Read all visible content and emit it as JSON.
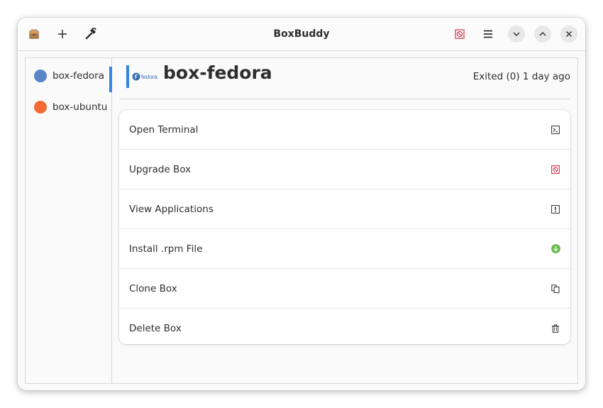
{
  "window": {
    "title": "BoxBuddy",
    "app_icon": "package-icon",
    "header_left": [
      {
        "name": "add-box-button",
        "icon": "plus-icon"
      },
      {
        "name": "tools-button",
        "icon": "hammer-icon"
      }
    ],
    "header_right": [
      {
        "name": "stop-button",
        "icon": "no-entry-icon"
      },
      {
        "name": "main-menu-button",
        "icon": "hamburger-icon"
      },
      {
        "name": "minimize-button",
        "icon": "chevron-down-icon"
      },
      {
        "name": "maximize-button",
        "icon": "chevron-up-icon"
      },
      {
        "name": "close-button",
        "icon": "close-icon"
      }
    ]
  },
  "sidebar": {
    "items": [
      {
        "label": "box-fedora",
        "color": "#5b85c6",
        "selected": true
      },
      {
        "label": "box-ubuntu",
        "color": "#f26a35",
        "selected": false
      }
    ]
  },
  "main": {
    "logo_text": "fedora",
    "box_name": "box-fedora",
    "status": "Exited (0) 1 day ago",
    "actions": [
      {
        "label": "Open Terminal",
        "icon": "terminal-icon"
      },
      {
        "label": "Upgrade Box",
        "icon": "no-entry-icon"
      },
      {
        "label": "View Applications",
        "icon": "app-list-icon"
      },
      {
        "label": "Install .rpm File",
        "icon": "download-icon"
      },
      {
        "label": "Clone Box",
        "icon": "copy-icon"
      },
      {
        "label": "Delete Box",
        "icon": "trash-icon"
      }
    ]
  },
  "colors": {
    "accent": "#3584e4",
    "stop_red": "#d0334a",
    "download_green": "#6abf4b"
  }
}
